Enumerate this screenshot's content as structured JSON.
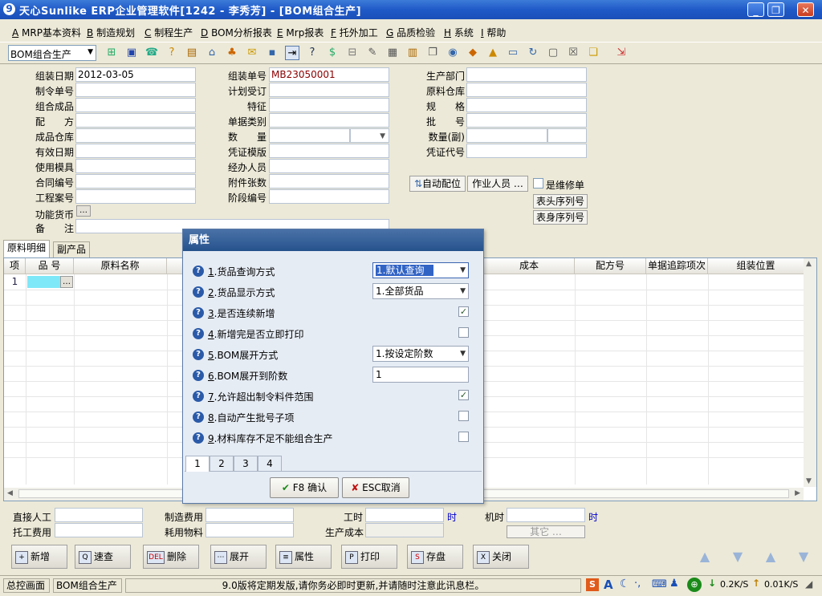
{
  "window": {
    "app_icon_char": "9",
    "title": "天心Sunlike ERP企业管理软件[1242 - 李秀芳] - [BOM组合生产]",
    "min_glyph": "_",
    "restore_glyph": "❐",
    "close_glyph": "✕"
  },
  "menu": [
    {
      "key": "A",
      "label": "MRP基本资料"
    },
    {
      "key": "B",
      "label": "制造规划"
    },
    {
      "key": "C",
      "label": "制程生产"
    },
    {
      "key": "D",
      "label": "BOM分析报表"
    },
    {
      "key": "E",
      "label": "Mrp报表"
    },
    {
      "key": "F",
      "label": "托外加工"
    },
    {
      "key": "G",
      "label": "品质检验"
    },
    {
      "key": "H",
      "label": "系统"
    },
    {
      "key": "I",
      "label": "帮助"
    }
  ],
  "toolbar": {
    "module_value": "BOM组合生产"
  },
  "header": {
    "assembly_date_label": "组装日期",
    "assembly_date_value": "2012-03-05",
    "order_no_label": "制令单号",
    "combo_product_label": "组合成品",
    "formula_label": "配　　方",
    "product_wh_label": "成品仓库",
    "valid_date_label": "有效日期",
    "mold_label": "使用模具",
    "contract_label": "合同编号",
    "project_label": "工程案号",
    "currency_label": "功能货币",
    "remark_label": "备　　注",
    "assembly_no_label": "组装单号",
    "assembly_no_value": "MB23050001",
    "plan_label": "计划受订",
    "feature_label": "特征",
    "doc_type_label": "单据类别",
    "qty_label": "数　　量",
    "voucher_tpl_label": "凭证模版",
    "handler_label": "经办人员",
    "attach_label": "附件张数",
    "stage_label": "阶段编号",
    "dept_label": "生产部门",
    "material_wh_label": "原料仓库",
    "spec_label": "规　　格",
    "batch_label": "批　　号",
    "qty_sub_label": "数量(副)",
    "voucher_code_label": "凭证代号",
    "auto_alloc_label": "自动配位",
    "operator_label": "作业人员 …",
    "repair_label": "是维修单",
    "head_serial_label": "表头序列号",
    "body_serial_label": "表身序列号",
    "ellipsis": "…"
  },
  "tabs": [
    {
      "label": "原料明细"
    },
    {
      "label": "副产品"
    }
  ],
  "grid": {
    "columns": {
      "idx": "项",
      "item_no": "品 号",
      "material_name": "原料名称",
      "cost": "成本",
      "formula_no": "配方号",
      "trace": "单据追踪项次",
      "position": "组装位置"
    },
    "rows": [
      {
        "idx": "1"
      }
    ]
  },
  "dialog": {
    "title": "属性",
    "help_glyph": "?",
    "options": [
      {
        "num": "1",
        "text": ".货品查询方式",
        "kind": "select",
        "value": "1.默认查询",
        "active": true
      },
      {
        "num": "2",
        "text": ".货品显示方式",
        "kind": "select",
        "value": "1.全部货品"
      },
      {
        "num": "3",
        "text": ".是否连续新增",
        "kind": "check",
        "checked": true
      },
      {
        "num": "4",
        "text": ".新增完是否立即打印",
        "kind": "check",
        "checked": false
      },
      {
        "num": "5",
        "text": ".BOM展开方式",
        "kind": "select",
        "value": "1.按设定阶数"
      },
      {
        "num": "6",
        "text": ".BOM展开到阶数",
        "kind": "input",
        "value": "1"
      },
      {
        "num": "7",
        "text": ".允许超出制令料件范围",
        "kind": "check",
        "checked": true
      },
      {
        "num": "8",
        "text": ".自动产生批号子项",
        "kind": "check",
        "checked": false
      },
      {
        "num": "9",
        "text": ".材料库存不足不能组合生产",
        "kind": "check",
        "checked": false
      }
    ],
    "pages": [
      "1",
      "2",
      "3",
      "4"
    ],
    "active_page": "1",
    "ok_label": "F8 确认",
    "cancel_label": "ESC取消",
    "check_glyph": "✓",
    "ok_glyph": "✔",
    "cancel_glyph": "✘"
  },
  "footer": {
    "direct_labor_label": "直接人工",
    "outsource_fee_label": "托工费用",
    "mfg_cost_label": "制造费用",
    "consumable_label": "耗用物料",
    "work_hours_label": "工时",
    "hour_unit": "时",
    "machine_hours_label": "机时",
    "production_cost_label": "生产成本",
    "other_label": "其它 …"
  },
  "actions": [
    {
      "label": "新增",
      "icon": "+"
    },
    {
      "label": "速查",
      "icon": "Q"
    },
    {
      "label": "删除",
      "icon": "DEL"
    },
    {
      "label": "展开",
      "icon": "⋯"
    },
    {
      "label": "属性",
      "icon": "≡"
    },
    {
      "label": "打印",
      "icon": "P"
    },
    {
      "label": "存盘",
      "icon": "S"
    },
    {
      "label": "关闭",
      "icon": "X"
    }
  ],
  "status": {
    "home": "总控画面",
    "module": "BOM组合生产",
    "message": "9.0版将定期发版,请你务必即时更新,并请随时注意此讯息栏。",
    "down_rate": "0.2K/S",
    "up_rate": "0.01K/S",
    "ime_letter": "A"
  },
  "colors": {
    "title_bar": "#1f5ac8",
    "dialog_title": "#26528c",
    "highlight": "#3163c5",
    "value_red": "#8b0000",
    "hour_unit_blue": "#0000cc"
  }
}
